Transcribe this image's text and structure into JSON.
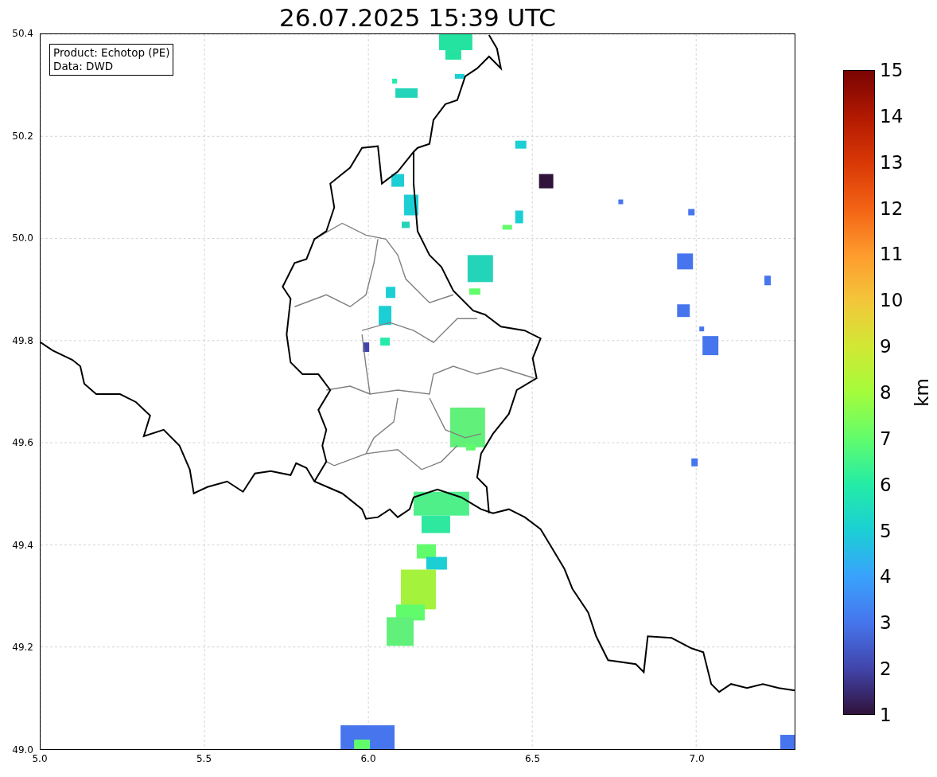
{
  "title": "26.07.2025 15:39 UTC",
  "info_box": {
    "lines": [
      "Product: Echotop (PE)",
      "Data: DWD"
    ]
  },
  "x_ticks": [
    "5.0",
    "5.5",
    "6.0",
    "6.5",
    "7.0"
  ],
  "y_ticks": [
    "50.4",
    "50.2",
    "50.0",
    "49.8",
    "49.6",
    "49.4",
    "49.2",
    "49.0"
  ],
  "colorbar": {
    "label": "km",
    "ticks": [
      "15",
      "14",
      "13",
      "12",
      "11",
      "10",
      "9",
      "8",
      "7",
      "6",
      "5",
      "4",
      "3",
      "2",
      "1"
    ]
  }
}
